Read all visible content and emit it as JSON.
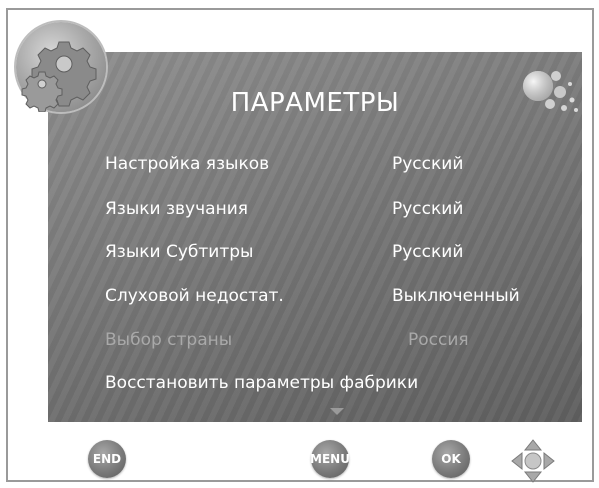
{
  "menu": {
    "title": "ПАРАМЕТРЫ",
    "items": [
      {
        "label": "Настройка языков",
        "value": "Русский",
        "enabled": true
      },
      {
        "label": "Языки звучания",
        "value": "Русский",
        "enabled": true
      },
      {
        "label": "Языки Субтитры",
        "value": "Русский",
        "enabled": true
      },
      {
        "label": "Слуховой недостат.",
        "value": "Выключенный",
        "enabled": true
      },
      {
        "label": "Выбор страны",
        "value": "Россия",
        "enabled": false
      },
      {
        "label": "Восстановить параметры фабрики",
        "value": "",
        "enabled": true
      }
    ]
  },
  "buttons": {
    "end": "END",
    "menu": "MENU",
    "ok": "OK"
  },
  "icons": {
    "badge": "gear-icon",
    "decor": "bubbles-icon",
    "scroll": "chevron-down-icon",
    "nav": "dpad-icon"
  },
  "colors": {
    "panel": "#7d7d7d",
    "text": "#ffffff",
    "disabled_text": "#a9a9a9",
    "button": "#7a7a7a"
  }
}
